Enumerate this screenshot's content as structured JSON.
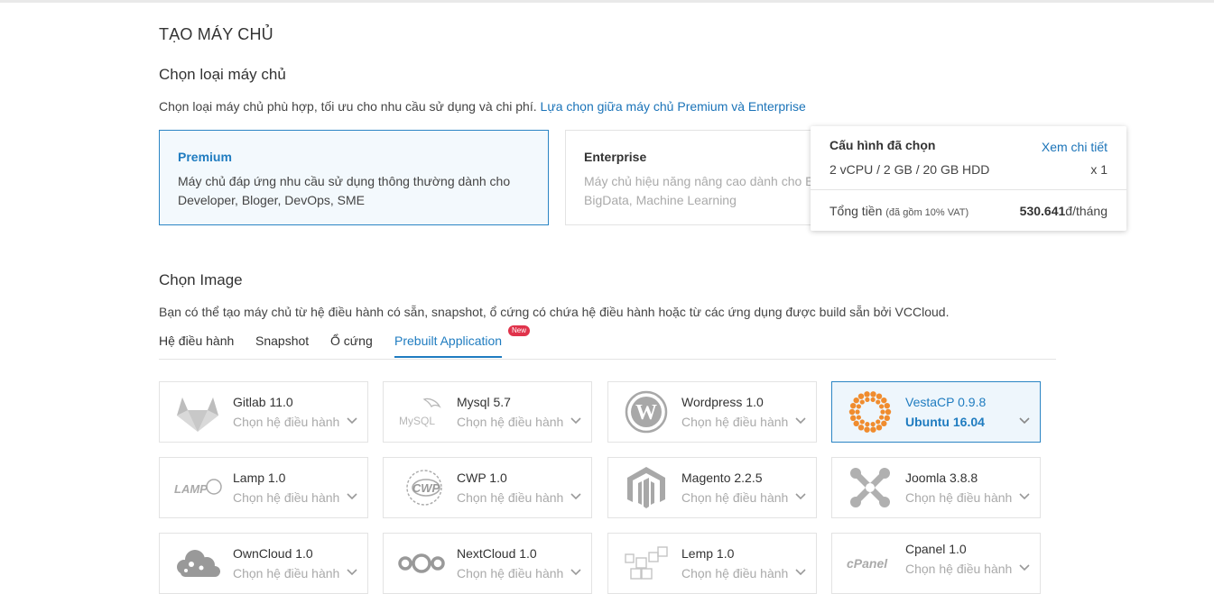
{
  "page": {
    "title": "TẠO MÁY CHỦ"
  },
  "server_type": {
    "heading": "Chọn loại máy chủ",
    "description": "Chọn loại máy chủ phù hợp, tối ưu cho nhu cầu sử dụng và chi phí.",
    "compare_link": "Lựa chọn giữa máy chủ Premium và Enterprise",
    "options": [
      {
        "title": "Premium",
        "line1": "Máy chủ đáp ứng nhu cầu sử dụng thông thường dành cho",
        "line2": "Developer, Bloger, DevOps, SME",
        "selected": true
      },
      {
        "title": "Enterprise",
        "line1": "Máy chủ hiệu năng nâng cao dành cho Ec",
        "line2": "BigData, Machine Learning",
        "selected": false
      }
    ]
  },
  "summary": {
    "heading": "Cấu hình đã chọn",
    "details_link": "Xem chi tiết",
    "config": "2 vCPU / 2 GB / 20 GB HDD",
    "quantity": "x 1",
    "total_label": "Tổng tiền",
    "vat_note": "(đã gồm 10% VAT)",
    "price": "530.641",
    "price_unit": "đ/tháng"
  },
  "image": {
    "heading": "Chọn Image",
    "description": "Bạn có thể tạo máy chủ từ hệ điều hành có sẵn, snapshot, ổ cứng có chứa hệ điều hành hoặc từ các ứng dụng được build sẵn bởi VCCloud.",
    "tabs": [
      {
        "label": "Hệ điều hành"
      },
      {
        "label": "Snapshot"
      },
      {
        "label": "Ổ cứng"
      },
      {
        "label": "Prebuilt Application",
        "active": true
      }
    ],
    "new_badge": "New"
  },
  "apps": [
    {
      "name": "Gitlab 11.0",
      "os": "Chọn hệ điều hành",
      "icon": "gitlab-icon"
    },
    {
      "name": "Mysql 5.7",
      "os": "Chọn hệ điều hành",
      "icon": "mysql-icon"
    },
    {
      "name": "Wordpress 1.0",
      "os": "Chọn hệ điều hành",
      "icon": "wordpress-icon"
    },
    {
      "name": "VestaCP 0.9.8",
      "os": "Ubuntu 16.04",
      "icon": "vestacp-icon",
      "selected": true
    },
    {
      "name": "Lamp 1.0",
      "os": "Chọn hệ điều hành",
      "icon": "lamp-icon",
      "logo_text": "LAMP"
    },
    {
      "name": "CWP 1.0",
      "os": "Chọn hệ điều hành",
      "icon": "cwp-icon",
      "logo_text": "CWP"
    },
    {
      "name": "Magento 2.2.5",
      "os": "Chọn hệ điều hành",
      "icon": "magento-icon"
    },
    {
      "name": "Joomla 3.8.8",
      "os": "Chọn hệ điều hành",
      "icon": "joomla-icon"
    },
    {
      "name": "OwnCloud 1.0",
      "os": "Chọn hệ điều hành",
      "icon": "owncloud-icon"
    },
    {
      "name": "NextCloud 1.0",
      "os": "Chọn hệ điều hành",
      "icon": "nextcloud-icon"
    },
    {
      "name": "Lemp 1.0",
      "os": "Chọn hệ điều hành",
      "icon": "lemp-icon"
    },
    {
      "name": "Cpanel 1.0",
      "os": "Chọn hệ điều hành",
      "icon": "cpanel-icon",
      "logo_text": "cPanel"
    }
  ],
  "colors": {
    "accent": "#1f7cc0",
    "selected_bg": "#eef6fc",
    "badge": "#e0334b",
    "vesta": "#f08c2e"
  }
}
